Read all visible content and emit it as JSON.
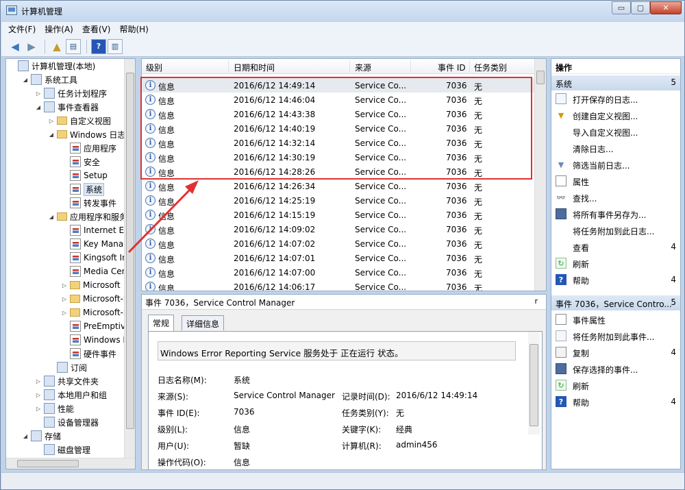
{
  "window": {
    "title": "计算机管理",
    "caption_buttons": {
      "minimize": "▭",
      "maximize": "▢",
      "close": "✕"
    }
  },
  "menu": [
    "文件(F)",
    "操作(A)",
    "查看(V)",
    "帮助(H)"
  ],
  "toolbar": {
    "icons": [
      "back-arrow-icon",
      "forward-arrow-icon",
      "up-folder-icon",
      "show-hide-tree-icon",
      "help-icon",
      "show-hide-action-pane-icon"
    ]
  },
  "tree": {
    "items": [
      {
        "label": "计算机管理(本地)",
        "icon": "computer-icon",
        "level": 0,
        "expander": ""
      },
      {
        "label": "系统工具",
        "icon": "tools-icon",
        "level": 1,
        "expander": "◢"
      },
      {
        "label": "任务计划程序",
        "icon": "clock-icon",
        "level": 2,
        "expander": "▷"
      },
      {
        "label": "事件查看器",
        "icon": "event-viewer-icon",
        "level": 2,
        "expander": "◢"
      },
      {
        "label": "自定义视图",
        "icon": "folder-icon",
        "level": 3,
        "expander": "▷"
      },
      {
        "label": "Windows 日志",
        "icon": "folder-icon",
        "level": 3,
        "expander": "◢"
      },
      {
        "label": "应用程序",
        "icon": "log-icon",
        "level": 4,
        "expander": ""
      },
      {
        "label": "安全",
        "icon": "log-icon",
        "level": 4,
        "expander": ""
      },
      {
        "label": "Setup",
        "icon": "log-icon",
        "level": 4,
        "expander": ""
      },
      {
        "label": "系统",
        "icon": "log-icon",
        "level": 4,
        "expander": "",
        "selected": true
      },
      {
        "label": "转发事件",
        "icon": "log-icon",
        "level": 4,
        "expander": ""
      },
      {
        "label": "应用程序和服务日",
        "icon": "folder-icon",
        "level": 3,
        "expander": "◢"
      },
      {
        "label": "Internet Exp",
        "icon": "log-icon",
        "level": 4,
        "expander": ""
      },
      {
        "label": "Key Manage",
        "icon": "log-icon",
        "level": 4,
        "expander": ""
      },
      {
        "label": "Kingsoft Inte",
        "icon": "log-icon",
        "level": 4,
        "expander": ""
      },
      {
        "label": "Media Cente",
        "icon": "log-icon",
        "level": 4,
        "expander": ""
      },
      {
        "label": "Microsoft",
        "icon": "folder-icon",
        "level": 4,
        "expander": "▷"
      },
      {
        "label": "Microsoft-S",
        "icon": "folder-icon",
        "level": 4,
        "expander": "▷"
      },
      {
        "label": "Microsoft-S",
        "icon": "folder-icon",
        "level": 4,
        "expander": "▷"
      },
      {
        "label": "PreEmptive",
        "icon": "log-icon",
        "level": 4,
        "expander": ""
      },
      {
        "label": "Windows Po",
        "icon": "log-icon",
        "level": 4,
        "expander": ""
      },
      {
        "label": "硬件事件",
        "icon": "log-icon",
        "level": 4,
        "expander": ""
      },
      {
        "label": "订阅",
        "icon": "subscription-icon",
        "level": 3,
        "expander": ""
      },
      {
        "label": "共享文件夹",
        "icon": "shared-folder-icon",
        "level": 2,
        "expander": "▷"
      },
      {
        "label": "本地用户和组",
        "icon": "users-icon",
        "level": 2,
        "expander": "▷"
      },
      {
        "label": "性能",
        "icon": "performance-icon",
        "level": 2,
        "expander": "▷"
      },
      {
        "label": "设备管理器",
        "icon": "device-manager-icon",
        "level": 2,
        "expander": ""
      },
      {
        "label": "存储",
        "icon": "storage-icon",
        "level": 1,
        "expander": "◢"
      },
      {
        "label": "磁盘管理",
        "icon": "disk-icon",
        "level": 2,
        "expander": ""
      }
    ]
  },
  "event_list": {
    "columns": [
      "级别",
      "日期和时间",
      "来源",
      "事件 ID",
      "任务类别"
    ],
    "rows": [
      {
        "level": "信息",
        "datetime": "2016/6/12 14:49:14",
        "source": "Service Co...",
        "event_id": "7036",
        "category": "无"
      },
      {
        "level": "信息",
        "datetime": "2016/6/12 14:46:04",
        "source": "Service Co...",
        "event_id": "7036",
        "category": "无"
      },
      {
        "level": "信息",
        "datetime": "2016/6/12 14:43:38",
        "source": "Service Co...",
        "event_id": "7036",
        "category": "无"
      },
      {
        "level": "信息",
        "datetime": "2016/6/12 14:40:19",
        "source": "Service Co...",
        "event_id": "7036",
        "category": "无"
      },
      {
        "level": "信息",
        "datetime": "2016/6/12 14:32:14",
        "source": "Service Co...",
        "event_id": "7036",
        "category": "无"
      },
      {
        "level": "信息",
        "datetime": "2016/6/12 14:30:19",
        "source": "Service Co...",
        "event_id": "7036",
        "category": "无"
      },
      {
        "level": "信息",
        "datetime": "2016/6/12 14:28:26",
        "source": "Service Co...",
        "event_id": "7036",
        "category": "无"
      },
      {
        "level": "信息",
        "datetime": "2016/6/12 14:26:34",
        "source": "Service Co...",
        "event_id": "7036",
        "category": "无"
      },
      {
        "level": "信息",
        "datetime": "2016/6/12 14:25:19",
        "source": "Service Co...",
        "event_id": "7036",
        "category": "无"
      },
      {
        "level": "信息",
        "datetime": "2016/6/12 14:15:19",
        "source": "Service Co...",
        "event_id": "7036",
        "category": "无"
      },
      {
        "level": "信息",
        "datetime": "2016/6/12 14:09:02",
        "source": "Service Co...",
        "event_id": "7036",
        "category": "无"
      },
      {
        "level": "信息",
        "datetime": "2016/6/12 14:07:02",
        "source": "Service Co...",
        "event_id": "7036",
        "category": "无"
      },
      {
        "level": "信息",
        "datetime": "2016/6/12 14:07:01",
        "source": "Service Co...",
        "event_id": "7036",
        "category": "无"
      },
      {
        "level": "信息",
        "datetime": "2016/6/12 14:07:00",
        "source": "Service Co...",
        "event_id": "7036",
        "category": "无"
      },
      {
        "level": "信息",
        "datetime": "2016/6/12 14:06:17",
        "source": "Service Co...",
        "event_id": "7036",
        "category": "无"
      }
    ]
  },
  "detail": {
    "header": "事件 7036，Service Control Manager",
    "close": "r",
    "tabs": [
      "常规",
      "详细信息"
    ],
    "description": "Windows Error Reporting Service 服务处于 正在运行 状态。",
    "fields": {
      "log_name_label": "日志名称(M):",
      "log_name": "系统",
      "source_label": "来源(S):",
      "source": "Service Control Manager",
      "logged_label": "记录时间(D):",
      "logged": "2016/6/12 14:49:14",
      "event_id_label": "事件 ID(E):",
      "event_id": "7036",
      "task_category_label": "任务类别(Y):",
      "task_category": "无",
      "level_label": "级别(L):",
      "level": "信息",
      "keywords_label": "关键字(K):",
      "keywords": "经典",
      "user_label": "用户(U):",
      "user": "暂缺",
      "computer_label": "计算机(R):",
      "computer": "admin456",
      "opcode_label": "操作代码(O):",
      "opcode": "信息"
    }
  },
  "actions": {
    "title": "操作",
    "section1": {
      "label": "系统",
      "count": "5"
    },
    "items1": [
      {
        "label": "打开保存的日志...",
        "icon": "open-log-icon",
        "count": ""
      },
      {
        "label": "创建自定义视图...",
        "icon": "filter-create-icon",
        "count": ""
      },
      {
        "label": "导入自定义视图...",
        "icon": "",
        "count": ""
      },
      {
        "label": "清除日志...",
        "icon": "",
        "count": ""
      },
      {
        "label": "筛选当前日志...",
        "icon": "filter-icon",
        "count": ""
      },
      {
        "label": "属性",
        "icon": "properties-icon",
        "count": ""
      },
      {
        "label": "查找...",
        "icon": "find-icon",
        "count": ""
      },
      {
        "label": "将所有事件另存为...",
        "icon": "save-icon",
        "count": ""
      },
      {
        "label": "将任务附加到此日志...",
        "icon": "",
        "count": ""
      },
      {
        "label": "查看",
        "icon": "",
        "count": "4"
      },
      {
        "label": "刷新",
        "icon": "refresh-icon",
        "count": ""
      },
      {
        "label": "帮助",
        "icon": "help-icon",
        "count": "4"
      }
    ],
    "section2": {
      "label": "事件 7036，Service Contro...",
      "count": "5"
    },
    "items2": [
      {
        "label": "事件属性",
        "icon": "properties-icon",
        "count": ""
      },
      {
        "label": "将任务附加到此事件...",
        "icon": "attach-task-icon",
        "count": ""
      },
      {
        "label": "复制",
        "icon": "copy-icon",
        "count": "4"
      },
      {
        "label": "保存选择的事件...",
        "icon": "save-icon",
        "count": ""
      },
      {
        "label": "刷新",
        "icon": "refresh-icon",
        "count": ""
      },
      {
        "label": "帮助",
        "icon": "help-icon",
        "count": "4"
      }
    ]
  },
  "colors": {
    "highlight_box": "#e03131",
    "annotation_arrow": "#e03131"
  }
}
